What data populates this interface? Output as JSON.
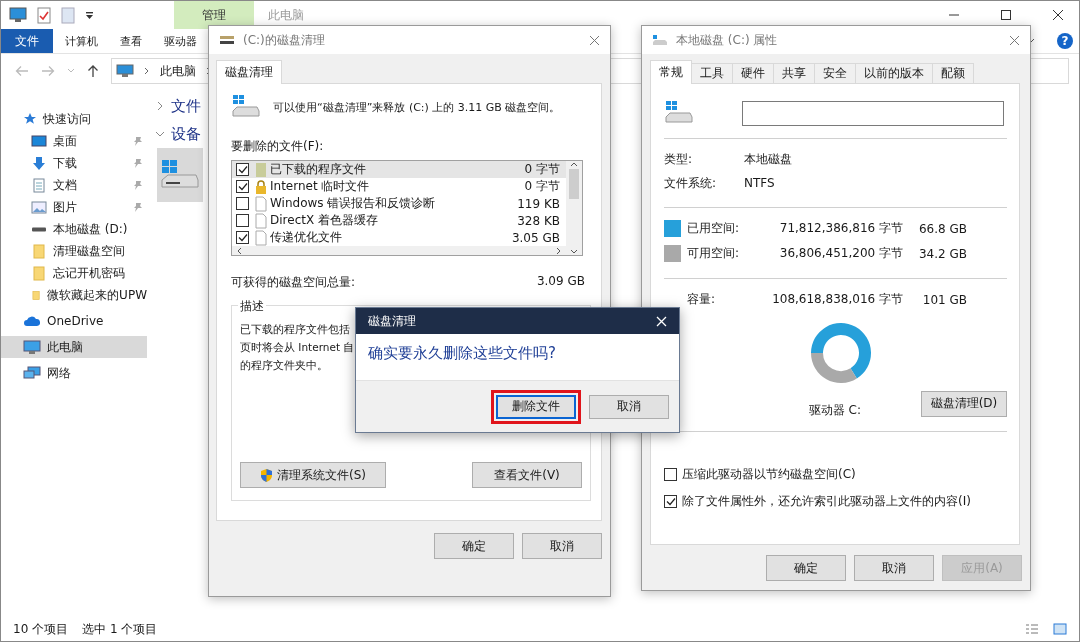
{
  "explorer": {
    "context_tab": "管理",
    "title": "此电脑",
    "ribbon_tabs": [
      {
        "label": "文件",
        "kind": "file"
      },
      {
        "label": "计算机",
        "kind": "tab"
      },
      {
        "label": "查看",
        "kind": "tab"
      },
      {
        "label": "驱动器",
        "kind": "tab"
      }
    ],
    "help": "?",
    "address": {
      "path": "此电脑"
    },
    "sidebar": [
      {
        "label": "快速访问",
        "kind": "star",
        "selected": false,
        "children": [
          {
            "label": "桌面",
            "kind": "desktop",
            "pinned": true,
            "selected": false
          },
          {
            "label": "下载",
            "kind": "download",
            "pinned": true,
            "selected": false
          },
          {
            "label": "文档",
            "kind": "document",
            "pinned": true,
            "selected": false
          },
          {
            "label": "图片",
            "kind": "image",
            "pinned": true,
            "selected": false
          },
          {
            "label": "本地磁盘 (D:)",
            "kind": "drive",
            "pinned": false,
            "selected": false
          },
          {
            "label": "清理磁盘空间",
            "kind": "folder",
            "pinned": false,
            "selected": false
          },
          {
            "label": "忘记开机密码",
            "kind": "folder",
            "pinned": false,
            "selected": false
          },
          {
            "label": "微软藏起来的UPW",
            "kind": "folder",
            "pinned": false,
            "selected": false
          }
        ]
      },
      {
        "label": "OneDrive",
        "kind": "cloud",
        "selected": false
      },
      {
        "label": "此电脑",
        "kind": "pc",
        "selected": true
      },
      {
        "label": "网络",
        "kind": "network",
        "selected": false
      }
    ],
    "sections": [
      {
        "label": "文件",
        "expanded": false
      },
      {
        "label": "设备",
        "expanded": true,
        "items": [
          {
            "selected": true
          }
        ]
      }
    ],
    "status_bar": {
      "items": "10 个项目",
      "selection": "选中 1 个项目"
    }
  },
  "cleanup": {
    "title": "(C:)的磁盘清理",
    "tab": "磁盘清理",
    "intro": "可以使用“磁盘清理”来释放 (C:) 上的 3.11 GB 磁盘空间。",
    "files_label": "要删除的文件(F):",
    "files": [
      {
        "name": "已下载的程序文件",
        "size": "0 字节",
        "checked": true,
        "selected": true,
        "kind": "folder"
      },
      {
        "name": "Internet 临时文件",
        "size": "0 字节",
        "checked": true,
        "selected": false,
        "kind": "lock"
      },
      {
        "name": "Windows 错误报告和反馈诊断",
        "size": "119 KB",
        "checked": false,
        "selected": false,
        "kind": "file"
      },
      {
        "name": "DirectX 着色器缓存",
        "size": "328 KB",
        "checked": false,
        "selected": false,
        "kind": "file"
      },
      {
        "name": "传递优化文件",
        "size": "3.05 GB",
        "checked": true,
        "selected": false,
        "kind": "file"
      }
    ],
    "total_label": "可获得的磁盘空间总量:",
    "total": "3.09 GB",
    "description_label": "描述",
    "description_lines": [
      "已下载的程序文件包括",
      "页时将会从 Internet 自",
      "的程序文件夹中。"
    ],
    "buttons": [
      {
        "label": "清理系统文件(S)",
        "kind": "shield"
      },
      {
        "label": "查看文件(V)",
        "kind": "plain"
      }
    ],
    "dialog_buttons": [
      "确定",
      "取消"
    ]
  },
  "properties": {
    "title": "本地磁盘 (C:) 属性",
    "tabs": [
      {
        "label": "常规",
        "selected": true
      },
      {
        "label": "工具",
        "selected": false
      },
      {
        "label": "硬件",
        "selected": false
      },
      {
        "label": "共享",
        "selected": false
      },
      {
        "label": "安全",
        "selected": false
      },
      {
        "label": "以前的版本",
        "selected": false
      },
      {
        "label": "配额",
        "selected": false
      }
    ],
    "type_label": "类型:",
    "type": "本地磁盘",
    "fs_label": "文件系统:",
    "fs": "NTFS",
    "space": [
      {
        "label": "已用空间:",
        "bytes": "71,812,386,816 字节",
        "size": "66.8 GB",
        "color": "#26a0da"
      },
      {
        "label": "可用空间:",
        "bytes": "36,806,451,200 字节",
        "size": "34.2 GB",
        "color": "#a9a9a9"
      }
    ],
    "capacity": {
      "label": "容量:",
      "bytes": "108,618,838,016 字节",
      "size": "101 GB"
    },
    "chart_data": {
      "type": "donut",
      "values": [
        66.8,
        34.2
      ]
    },
    "drive_label": "驱动器 C:",
    "cleanup_button": "磁盘清理(D)",
    "options": [
      {
        "label": "压缩此驱动器以节约磁盘空间(C)",
        "checked": false
      },
      {
        "label": "除了文件属性外，还允许索引此驱动器上文件的内容(I)",
        "checked": true
      }
    ],
    "buttons": [
      {
        "label": "确定",
        "disabled": false
      },
      {
        "label": "取消",
        "disabled": false
      },
      {
        "label": "应用(A)",
        "disabled": true
      }
    ]
  },
  "confirm": {
    "title": "磁盘清理",
    "question": "确实要永久删除这些文件吗?",
    "buttons": [
      {
        "label": "删除文件",
        "default": true,
        "highlighted": true
      },
      {
        "label": "取消",
        "default": false,
        "highlighted": false
      }
    ]
  }
}
